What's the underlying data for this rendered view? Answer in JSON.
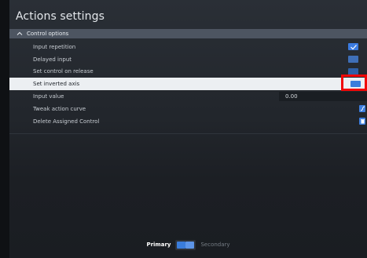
{
  "window": {
    "title": "Actions settings"
  },
  "section": {
    "label": "Control options",
    "icon": "chevron-up-icon"
  },
  "rows": [
    {
      "label": "Input repetition",
      "control": "checkbox",
      "checked": true
    },
    {
      "label": "Delayed input",
      "control": "toggle",
      "checked": false
    },
    {
      "label": "Set control on release",
      "control": "toggle",
      "checked": false
    },
    {
      "label": "Set inverted axis",
      "control": "toggle",
      "checked": false,
      "selected": true
    },
    {
      "label": "Input value",
      "control": "value",
      "value": "0.00"
    },
    {
      "label": "Tweak action curve",
      "control": "icon-button",
      "icon": "curve-icon"
    },
    {
      "label": "Delete Assigned Control",
      "control": "icon-button",
      "icon": "trash-icon"
    }
  ],
  "footer": {
    "primary_label": "Primary",
    "secondary_label": "Secondary",
    "active": "Primary"
  },
  "colors": {
    "accent": "#3a7ddc",
    "highlight_box": "#f00707"
  }
}
